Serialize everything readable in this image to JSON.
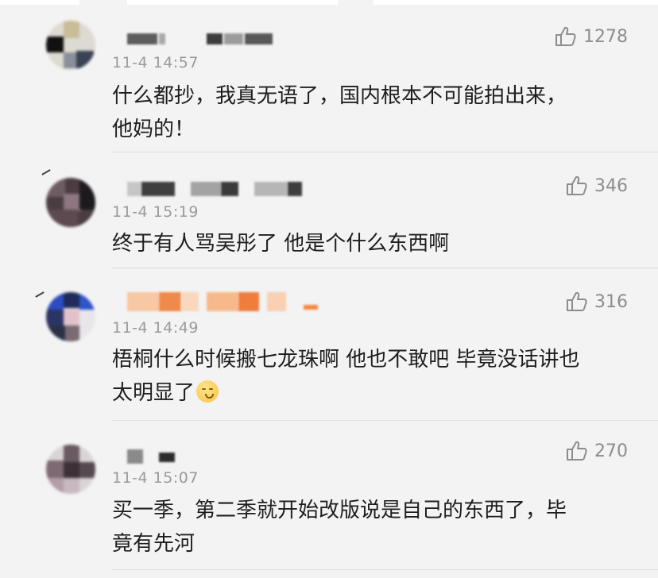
{
  "colors": {
    "background": "#f3f3f3",
    "divider": "#dedede",
    "meta_text": "#9a9a9a",
    "body_text": "#1e1e1e"
  },
  "like_icon": "thumbs-up-outline-icon",
  "comments": [
    {
      "time": "11-4 14:57",
      "likes": "1278",
      "text_lines": [
        "什么都抄，我真无语了，国内根本不可能拍出来，",
        "他妈的！"
      ]
    },
    {
      "time": "11-4 15:19",
      "likes": "346",
      "text_lines": [
        "终于有人骂吴彤了 他是个什么东西啊"
      ]
    },
    {
      "time": "11-4 14:49",
      "likes": "316",
      "text_lines": [
        "梧桐什么时候搬七龙珠啊 他也不敢吧 毕竟没话讲也",
        "太明显了"
      ],
      "emoji": "shushing-face-emoji"
    },
    {
      "time": "11-4 15:07",
      "likes": "270",
      "text_lines": [
        "买一季，第二季就开始改版说是自己的东西了，毕",
        "竟有先河"
      ]
    }
  ]
}
